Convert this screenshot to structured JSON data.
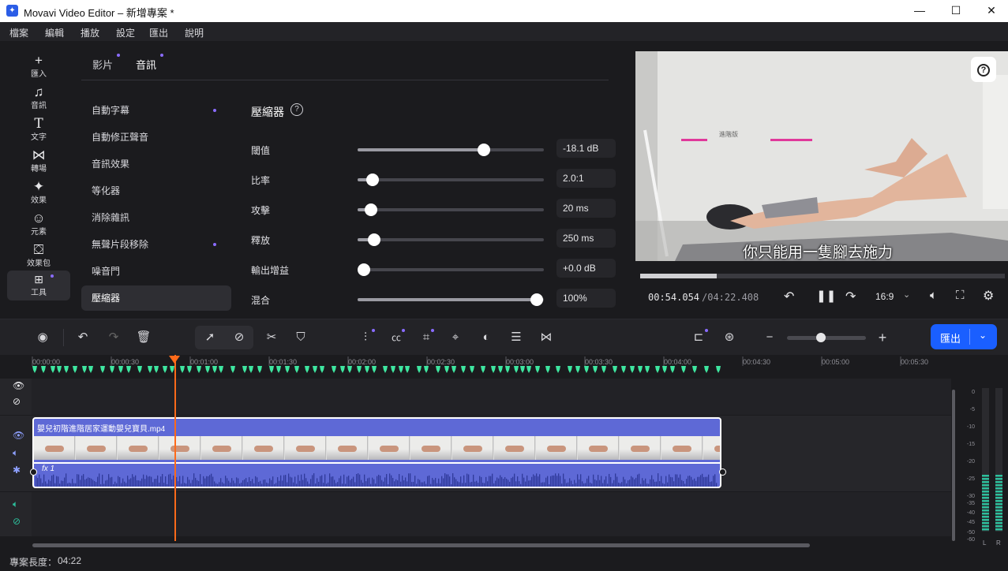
{
  "window": {
    "title": "Movavi Video Editor – 新增專案 *",
    "minimize": "—",
    "maximize": "☐",
    "close": "✕"
  },
  "menu": [
    "檔案",
    "編輯",
    "播放",
    "設定",
    "匯出",
    "說明"
  ],
  "sidebar": [
    {
      "label": "匯入",
      "icon": "plus-icon"
    },
    {
      "label": "音訊",
      "icon": "music-note-icon"
    },
    {
      "label": "文字",
      "icon": "text-icon"
    },
    {
      "label": "轉場",
      "icon": "transition-icon"
    },
    {
      "label": "效果",
      "icon": "sparkle-icon"
    },
    {
      "label": "元素",
      "icon": "sticker-icon"
    },
    {
      "label": "效果包",
      "icon": "effect-pack-icon"
    },
    {
      "label": "工具",
      "icon": "tools-icon"
    }
  ],
  "panel": {
    "tabs": [
      "影片",
      "音訊"
    ],
    "active_tab": "音訊",
    "tools": [
      "自動字幕",
      "自動修正聲音",
      "音訊效果",
      "等化器",
      "消除雜訊",
      "無聲片段移除",
      "噪音門",
      "壓縮器"
    ],
    "active_tool": "壓縮器",
    "section_title": "壓縮器",
    "params": [
      {
        "label": "閾值",
        "value": "-18.1 dB",
        "level": 0.68
      },
      {
        "label": "比率",
        "value": "2.0:1",
        "level": 0.08
      },
      {
        "label": "攻擊",
        "value": "20 ms",
        "level": 0.07
      },
      {
        "label": "釋放",
        "value": "250 ms",
        "level": 0.09
      },
      {
        "label": "輸出增益",
        "value": "+0.0 dB",
        "level": 0.0
      },
      {
        "label": "混合",
        "value": "100%",
        "level": 0.96
      }
    ]
  },
  "preview": {
    "subtitle": "你只能用一隻腳去施力",
    "overlay_small": "進階版",
    "time_current": "00:54.054",
    "time_total": "/04:22.408",
    "aspect": "16:9",
    "progress": 0.21
  },
  "toolbar": {
    "export_label": "匯出"
  },
  "ruler": [
    "00:00:00",
    "00:00:30",
    "00:01:00",
    "00:01:30",
    "00:02:00",
    "00:02:30",
    "00:03:00",
    "00:03:30",
    "00:04:00",
    "00:04:30",
    "00:05:00",
    "00:05:30"
  ],
  "clip": {
    "name": "嬰兒初階進階居家運動嬰兒寶貝.mp4",
    "fx": "fx 1"
  },
  "meter_labels": [
    "0",
    "-5",
    "-10",
    "-15",
    "-20",
    "-25",
    "-30",
    "-35",
    "-40",
    "-45",
    "-50",
    "-60"
  ],
  "meter_channels": [
    "L",
    "R"
  ],
  "footer": {
    "label": "專案長度：",
    "value": "04:22"
  },
  "colors": {
    "accent": "#1a5fff",
    "clip": "#5e69d6",
    "playhead": "#ff6a1a",
    "markers": "#3ee6a0",
    "meter": "#2dbf9c"
  }
}
